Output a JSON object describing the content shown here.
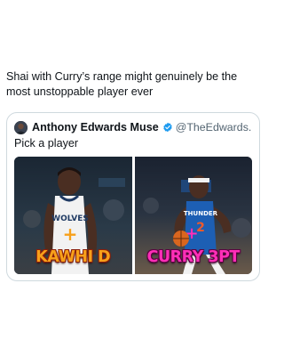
{
  "post": {
    "text": "Shai with Curry’s range might genuinely be the most unstoppable player ever"
  },
  "quote": {
    "author_name": "Anthony Edwards Muse",
    "handle": "@TheEdwards...",
    "text": "Pick a player",
    "media": {
      "left_label": "KAWHI D",
      "left_jersey_text": "WOLVES",
      "right_label": "CURRY 3PT",
      "right_jersey_text": "THUNDER",
      "right_jersey_number": "2",
      "plus_sign": "+"
    }
  },
  "colors": {
    "verified": "#1d9bf0",
    "handle": "#536471",
    "kawhi_label": "#f7a01a",
    "curry_label": "#ff2fb8"
  }
}
